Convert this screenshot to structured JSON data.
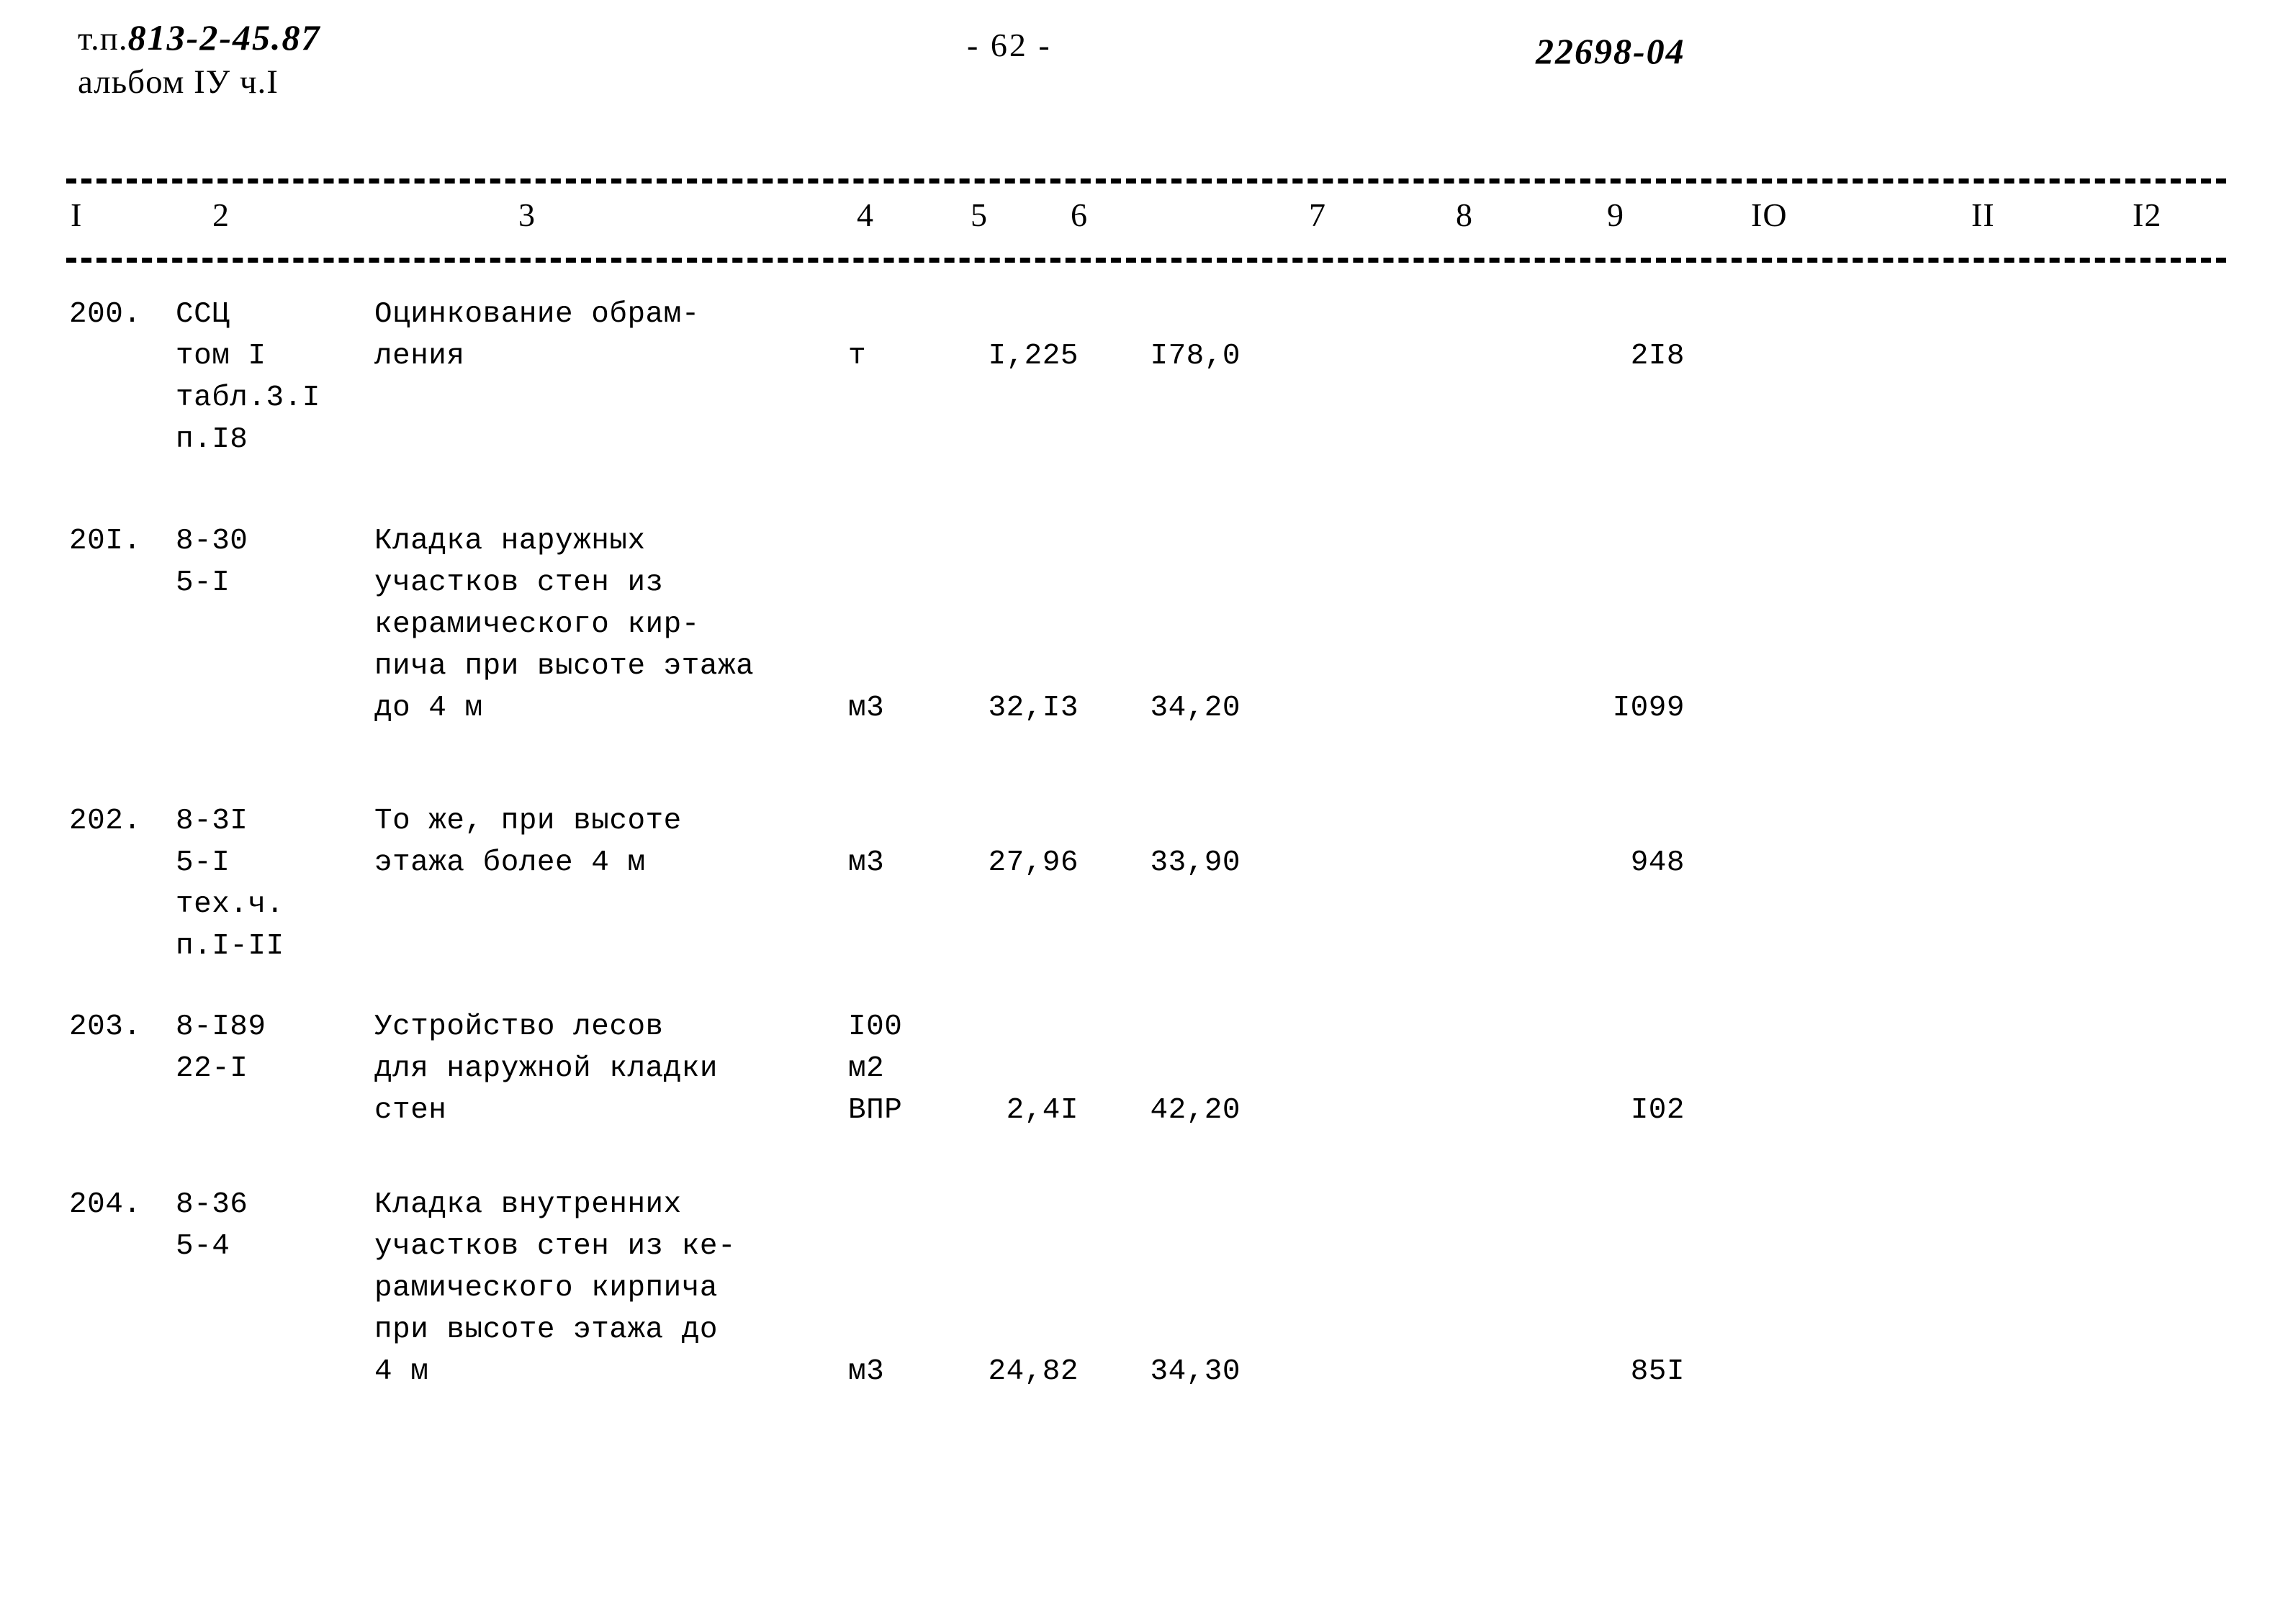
{
  "header": {
    "project_label": "т.п.",
    "project_code": "813-2-45.87",
    "album_line": "альбом IУ ч.I",
    "page_number": "- 62 -",
    "document_code": "22698-04"
  },
  "table": {
    "column_numbers": [
      "I",
      "2",
      "3",
      "4",
      "5",
      "6",
      "7",
      "8",
      "9",
      "IO",
      "II",
      "I2"
    ],
    "rows": [
      {
        "num": "200.",
        "code": "ССЦ\nтом I\nтабл.3.I\nп.I8",
        "description": "Оцинкование обрам-\nления",
        "unit": "т",
        "quantity": "I,225",
        "price": "I78,0",
        "total": "2I8",
        "unit_offset_lines": 1,
        "value_offset_lines": 1
      },
      {
        "num": "20I.",
        "code": "8-30\n5-I",
        "description": "Кладка наружных\nучастков стен из\nкерамического кир-\nпича при высоте этажа\nдо 4 м",
        "unit": "м3",
        "quantity": "32,I3",
        "price": "34,20",
        "total": "I099",
        "unit_offset_lines": 4,
        "value_offset_lines": 4
      },
      {
        "num": "202.",
        "code": "8-3I\n5-I\nтех.ч.\nп.I-II",
        "description": "То же, при высоте\nэтажа более 4 м",
        "unit": "м3",
        "quantity": "27,96",
        "price": "33,90",
        "total": "948",
        "unit_offset_lines": 1,
        "value_offset_lines": 1
      },
      {
        "num": "203.",
        "code": "8-I89\n22-I",
        "description": "Устройство лесов\nдля наружной кладки\nстен",
        "unit": "I00\nм2\nВПР",
        "quantity": "2,4I",
        "price": "42,20",
        "total": "I02",
        "unit_offset_lines": 0,
        "value_offset_lines": 2
      },
      {
        "num": "204.",
        "code": "8-36\n5-4",
        "description": "Кладка внутренних\nучастков стен из ке-\nрамического кирпича\nпри высоте этажа до\n4 м",
        "unit": "м3",
        "quantity": "24,82",
        "price": "34,30",
        "total": "85I",
        "unit_offset_lines": 4,
        "value_offset_lines": 4
      }
    ]
  }
}
